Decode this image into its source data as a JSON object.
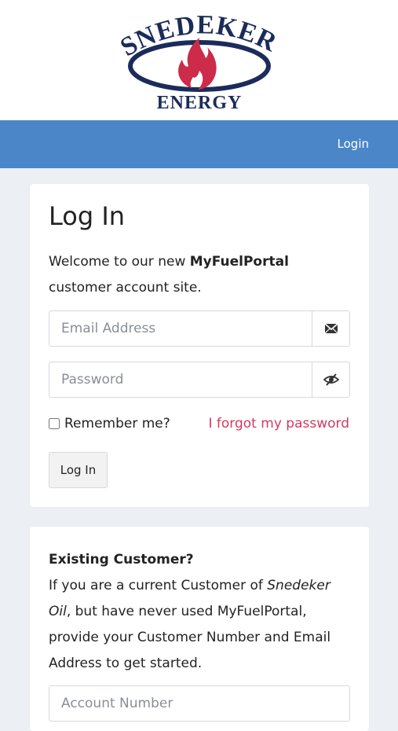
{
  "brand": {
    "logo_top": "SNEDEKER",
    "logo_bottom": "ENERGY",
    "primary_color": "#4a86c8",
    "logo_navy": "#1b2b5a",
    "logo_red": "#cc2b4a"
  },
  "nav": {
    "login_label": "Login"
  },
  "login_card": {
    "title": "Log In",
    "welcome_pre": "Welcome to our new ",
    "welcome_brand": "MyFuelPortal",
    "welcome_post": " customer account site.",
    "email_placeholder": "Email Address",
    "email_icon": "envelope-icon",
    "password_placeholder": "Password",
    "password_icon": "eye-slash-icon",
    "remember_label": "Remember me?",
    "forgot_label": "I forgot my password",
    "login_button": "Log In",
    "link_color": "#d23a5f"
  },
  "existing_card": {
    "title": "Existing Customer?",
    "text_pre": "If you are a current Customer of ",
    "text_company": "Snedeker Oil",
    "text_post": ", but have never used MyFuelPortal, provide your Customer Number and Email Address to get started.",
    "account_placeholder": "Account Number"
  }
}
